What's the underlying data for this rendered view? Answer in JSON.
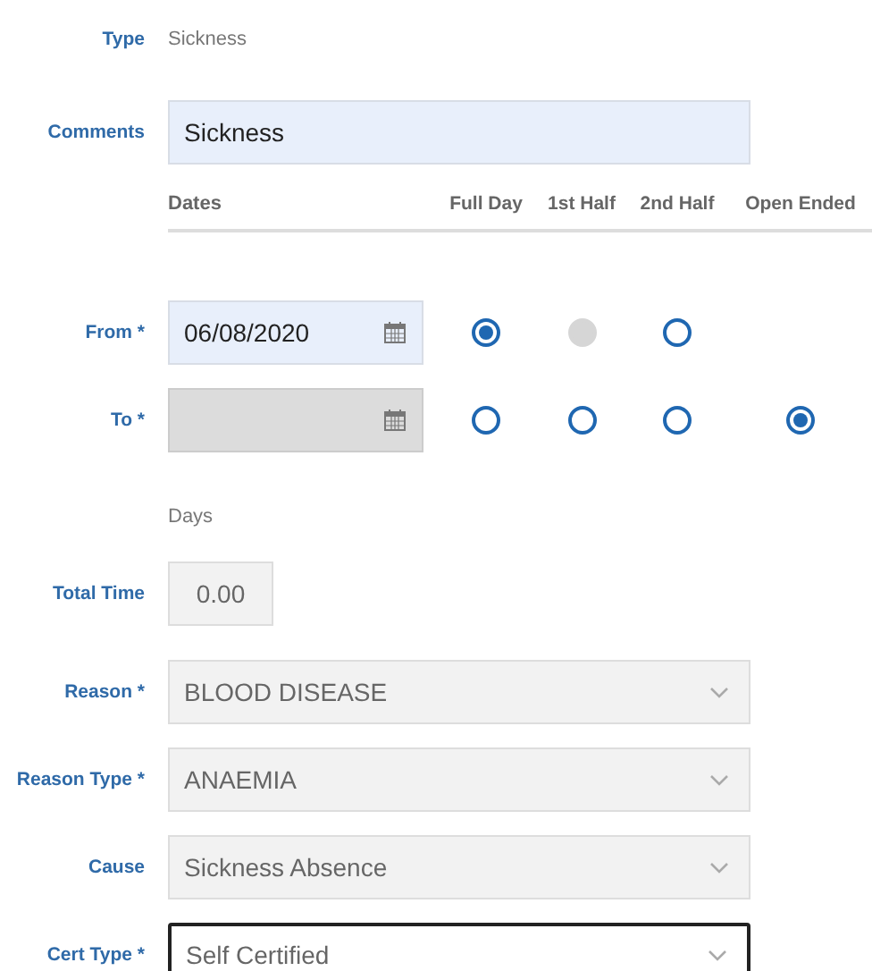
{
  "type": {
    "label": "Type",
    "value": "Sickness"
  },
  "comments": {
    "label": "Comments",
    "value": "Sickness"
  },
  "dates": {
    "heading": "Dates",
    "columns": [
      "Full Day",
      "1st Half",
      "2nd Half",
      "Open Ended"
    ],
    "rows": [
      {
        "label": "From *",
        "value": "06/08/2020",
        "disabled": false,
        "options": [
          {
            "selected": true,
            "disabled": false
          },
          {
            "selected": false,
            "disabled": true
          },
          {
            "selected": false,
            "disabled": false
          }
        ]
      },
      {
        "label": "To *",
        "value": "",
        "disabled": true,
        "options": [
          {
            "selected": false,
            "disabled": false
          },
          {
            "selected": false,
            "disabled": false
          },
          {
            "selected": false,
            "disabled": false
          },
          {
            "selected": true,
            "disabled": false
          }
        ]
      }
    ]
  },
  "total": {
    "unit": "Days",
    "label": "Total Time",
    "value": "0.00"
  },
  "selects": [
    {
      "label": "Reason *",
      "value": "BLOOD DISEASE",
      "disabled": true
    },
    {
      "label": "Reason Type *",
      "value": "ANAEMIA",
      "disabled": true
    },
    {
      "label": "Cause",
      "value": "Sickness Absence",
      "disabled": true
    },
    {
      "label": "Cert Type *",
      "value": "Self Certified",
      "disabled": false
    }
  ]
}
